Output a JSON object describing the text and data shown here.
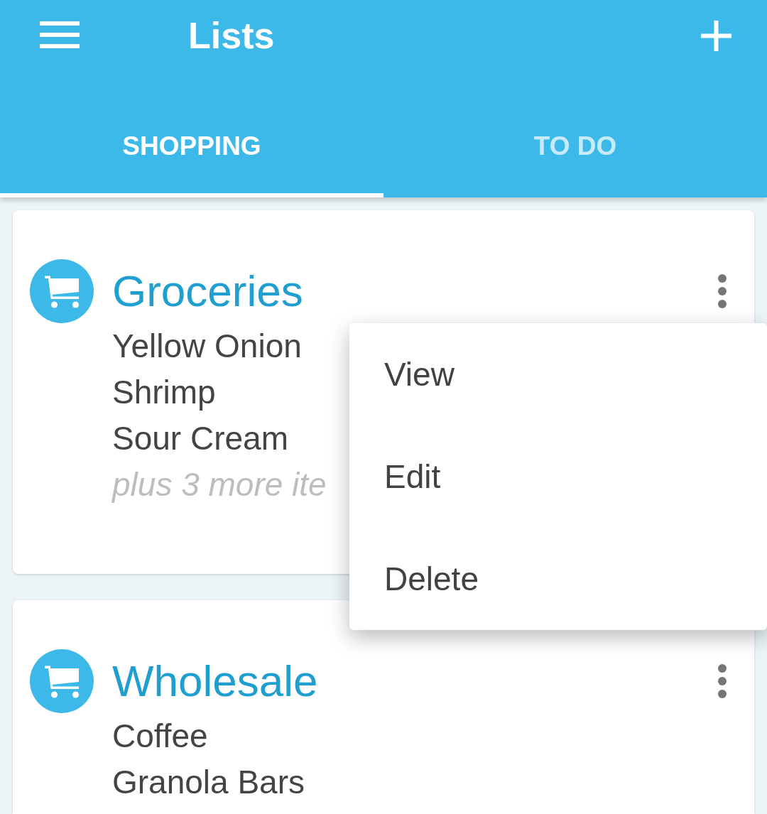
{
  "app_bar": {
    "title": "Lists"
  },
  "tabs": [
    {
      "label": "SHOPPING",
      "selected": true
    },
    {
      "label": "TO DO",
      "selected": false
    }
  ],
  "lists": [
    {
      "title": "Groceries",
      "items": [
        "Yellow Onion",
        "Shrimp",
        "Sour Cream"
      ],
      "more": "plus 3 more ite"
    },
    {
      "title": "Wholesale",
      "items": [
        "Coffee",
        "Granola Bars"
      ]
    }
  ],
  "popup_menu": {
    "items": [
      "View",
      "Edit",
      "Delete"
    ]
  }
}
